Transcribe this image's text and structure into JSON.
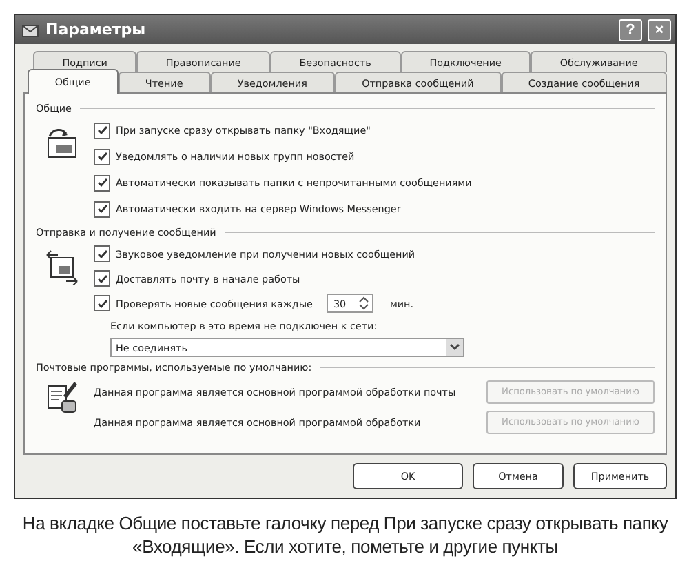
{
  "window": {
    "title": "Параметры",
    "buttons": [
      "?",
      "×"
    ]
  },
  "tab_rows": [
    {
      "tabs": [
        {
          "label": "Подписи",
          "selected": false
        },
        {
          "label": "Правописание",
          "selected": false
        },
        {
          "label": "Безопасность",
          "selected": false
        },
        {
          "label": "Подключение",
          "selected": false
        },
        {
          "label": "Обслуживание",
          "selected": false
        }
      ]
    },
    {
      "tabs": [
        {
          "label": "Общие",
          "selected": true
        },
        {
          "label": "Чтение",
          "selected": false
        },
        {
          "label": "Уведомления",
          "selected": false
        },
        {
          "label": "Отправка сообщений",
          "selected": false
        },
        {
          "label": "Создание сообщения",
          "selected": false
        }
      ]
    }
  ],
  "general": {
    "title": "Общие",
    "items": [
      {
        "label": "При запуске сразу открывать папку \"Входящие\"",
        "checked": true
      },
      {
        "label": "Уведомлять о наличии новых групп новостей",
        "checked": true
      },
      {
        "label": "Автоматически показывать папки с непрочитанными сообщениями",
        "checked": true
      },
      {
        "label": "Автоматически входить на сервер Windows Messenger",
        "checked": true
      }
    ]
  },
  "send_receive": {
    "title": "Отправка и получение сообщений",
    "items": [
      {
        "kind": "check",
        "label": "Звуковое уведомление при получении новых сообщений",
        "checked": true
      },
      {
        "kind": "check",
        "label": "Доставлять почту в начале работы",
        "checked": true
      },
      {
        "kind": "interval",
        "label": "Проверять новые сообщения каждые",
        "checked": true,
        "value": "30",
        "unit": "мин."
      }
    ],
    "offline_label": "Если компьютер в это время не подключен к сети:",
    "offline_value": "Не соединять"
  },
  "defaults": {
    "title": "Почтовые программы, используемые по умолчанию:",
    "rows": [
      {
        "text": "Данная программа является основной программой обработки почты",
        "button": "Использовать по умолчанию",
        "disabled": true
      },
      {
        "text": "Данная программа является основной программой обработки",
        "button": "Использовать по умолчанию",
        "disabled": true
      }
    ]
  },
  "buttons": [
    {
      "label": "OK"
    },
    {
      "label": "Отмена"
    },
    {
      "label": "Применить"
    }
  ],
  "caption": "На вкладке Общие поставьте галочку перед При запуске сразу открывать папку «Входящие». Если хотите, пометьте и другие пункты"
}
